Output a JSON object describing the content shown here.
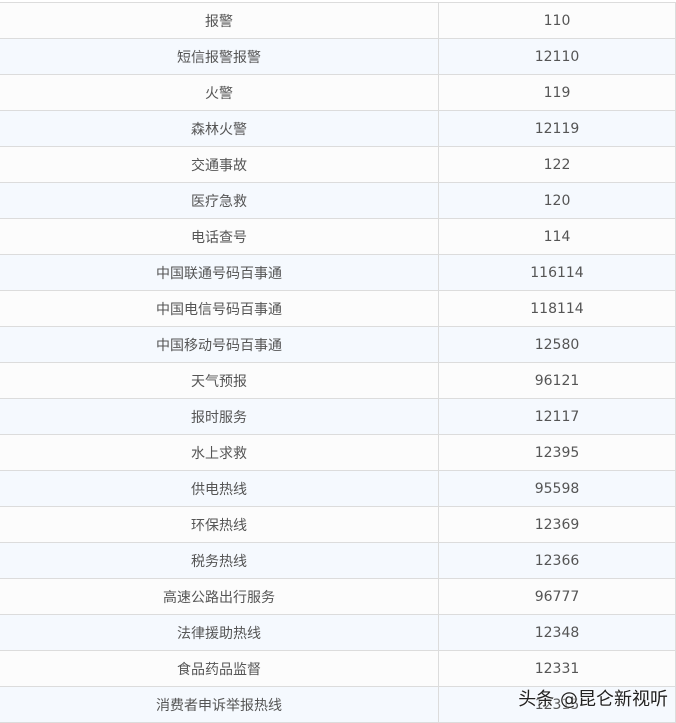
{
  "rows": [
    {
      "name": "报警",
      "number": "110"
    },
    {
      "name": "短信报警报警",
      "number": "12110"
    },
    {
      "name": "火警",
      "number": "119"
    },
    {
      "name": "森林火警",
      "number": "12119"
    },
    {
      "name": "交通事故",
      "number": "122"
    },
    {
      "name": "医疗急救",
      "number": "120"
    },
    {
      "name": "电话查号",
      "number": "114"
    },
    {
      "name": "中国联通号码百事通",
      "number": "116114"
    },
    {
      "name": "中国电信号码百事通",
      "number": "118114"
    },
    {
      "name": "中国移动号码百事通",
      "number": "12580"
    },
    {
      "name": "天气预报",
      "number": "96121"
    },
    {
      "name": "报时服务",
      "number": "12117"
    },
    {
      "name": "水上求救",
      "number": "12395"
    },
    {
      "name": "供电热线",
      "number": "95598"
    },
    {
      "name": "环保热线",
      "number": "12369"
    },
    {
      "name": "税务热线",
      "number": "12366"
    },
    {
      "name": "高速公路出行服务",
      "number": "96777"
    },
    {
      "name": "法律援助热线",
      "number": "12348"
    },
    {
      "name": "食品药品监督",
      "number": "12331"
    },
    {
      "name": "消费者申诉举报热线",
      "number": "12315"
    }
  ],
  "watermark": "头条 @昆仑新视听"
}
